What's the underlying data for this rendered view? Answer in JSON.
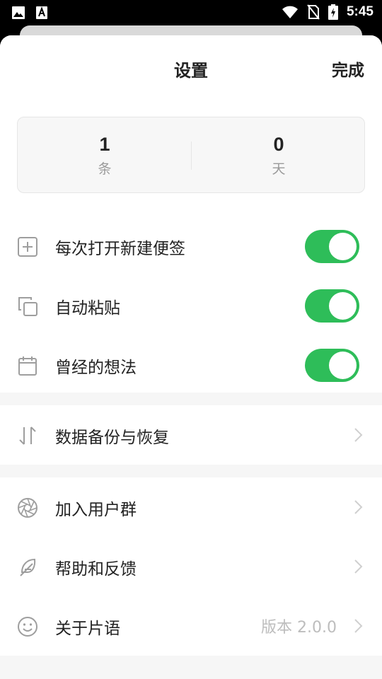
{
  "status_bar": {
    "time": "5:45"
  },
  "header": {
    "title": "设置",
    "done_label": "完成"
  },
  "stats": [
    {
      "value": "1",
      "unit": "条"
    },
    {
      "value": "0",
      "unit": "天"
    }
  ],
  "toggles": [
    {
      "label": "每次打开新建便签",
      "on": true,
      "icon": "plus-square-icon"
    },
    {
      "label": "自动粘贴",
      "on": true,
      "icon": "copy-icon"
    },
    {
      "label": "曾经的想法",
      "on": true,
      "icon": "calendar-icon"
    }
  ],
  "backup": {
    "label": "数据备份与恢复",
    "icon": "sort-arrows-icon"
  },
  "links": [
    {
      "label": "加入用户群",
      "icon": "aperture-icon"
    },
    {
      "label": "帮助和反馈",
      "icon": "feather-icon"
    },
    {
      "label": "关于片语",
      "icon": "smile-icon",
      "value": "版本 2.0.0"
    }
  ],
  "colors": {
    "accent": "#2ebd59",
    "background": "#f6f6f6"
  }
}
